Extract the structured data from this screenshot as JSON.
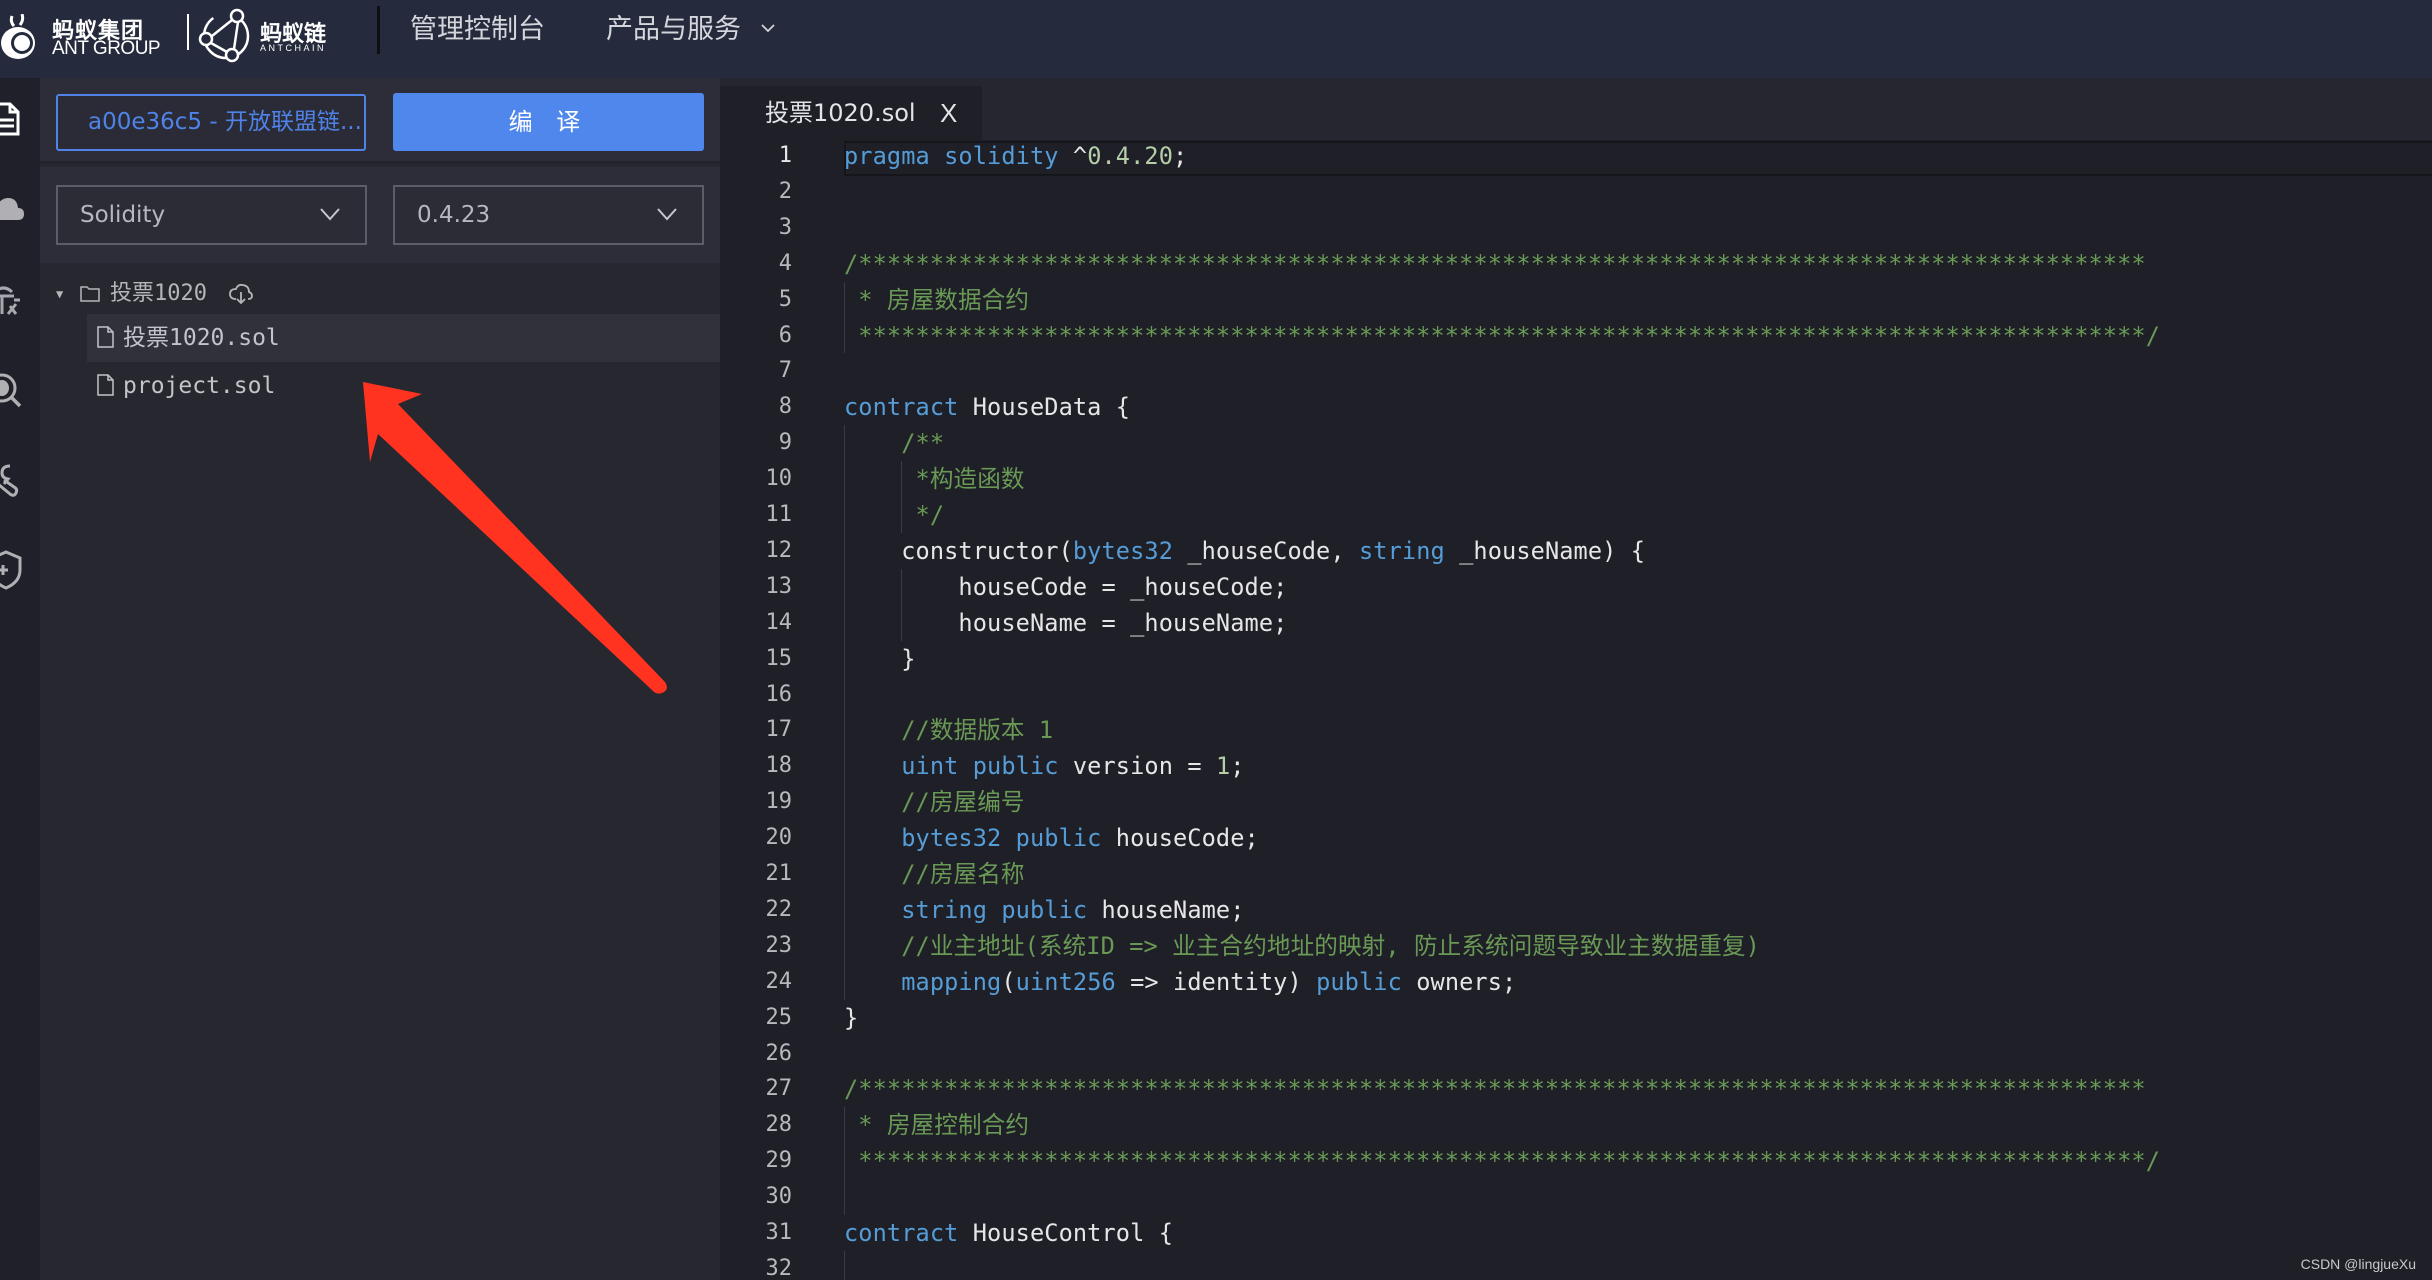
{
  "header": {
    "logo_ant_cn": "蚂蚁集团",
    "logo_ant_en": "ANT GROUP",
    "logo_chain_cn": "蚂蚁链",
    "logo_chain_en": "ANTCHAIN",
    "nav": [
      {
        "label": "管理控制台"
      },
      {
        "label": "产品与服务",
        "icon": "chevron-down-icon"
      }
    ]
  },
  "rail": {
    "icons": [
      "file-icon",
      "cloud-upload-icon",
      "bug-icon",
      "bug-search-icon",
      "wrench-icon",
      "shield-plus-icon"
    ]
  },
  "sidebar": {
    "chain_input": "a00e36c5 - 开放联盟链...",
    "compile_label": "编 译",
    "language_select": "Solidity",
    "version_select": "0.4.23",
    "tree": {
      "folder": {
        "name": "投票1020",
        "expanded": true
      },
      "files": [
        {
          "name": "投票1020.sol",
          "selected": true
        },
        {
          "name": "project.sol",
          "selected": false
        }
      ]
    }
  },
  "editor": {
    "tab": {
      "name": "投票1020.sol",
      "close": "X"
    },
    "active_line": 1,
    "lines": [
      [
        [
          "kw",
          "pragma solidity"
        ],
        [
          "pl",
          " ^"
        ],
        [
          "num",
          "0.4.20"
        ],
        [
          "pl",
          ";"
        ]
      ],
      [],
      [],
      [
        [
          "cm",
          "/******************************************************************************************"
        ]
      ],
      [
        [
          "cm",
          " * 房屋数据合约"
        ]
      ],
      [
        [
          "cm",
          " ******************************************************************************************/"
        ]
      ],
      [],
      [
        [
          "kw",
          "contract"
        ],
        [
          "pl",
          " HouseData {"
        ]
      ],
      [
        [
          "cm",
          "    /**"
        ]
      ],
      [
        [
          "cm",
          "     *构造函数"
        ]
      ],
      [
        [
          "cm",
          "     */"
        ]
      ],
      [
        [
          "pl",
          "    constructor("
        ],
        [
          "kw",
          "bytes32"
        ],
        [
          "pl",
          " _houseCode, "
        ],
        [
          "kw",
          "string"
        ],
        [
          "pl",
          " _houseName) {"
        ]
      ],
      [
        [
          "pl",
          "        houseCode = _houseCode;"
        ]
      ],
      [
        [
          "pl",
          "        houseName = _houseName;"
        ]
      ],
      [
        [
          "pl",
          "    }"
        ]
      ],
      [],
      [
        [
          "cm",
          "    //数据版本 1"
        ]
      ],
      [
        [
          "pl",
          "    "
        ],
        [
          "kw",
          "uint public"
        ],
        [
          "pl",
          " version = "
        ],
        [
          "num",
          "1"
        ],
        [
          "pl",
          ";"
        ]
      ],
      [
        [
          "cm",
          "    //房屋编号"
        ]
      ],
      [
        [
          "pl",
          "    "
        ],
        [
          "kw",
          "bytes32 public"
        ],
        [
          "pl",
          " houseCode;"
        ]
      ],
      [
        [
          "cm",
          "    //房屋名称"
        ]
      ],
      [
        [
          "pl",
          "    "
        ],
        [
          "kw",
          "string public"
        ],
        [
          "pl",
          " houseName;"
        ]
      ],
      [
        [
          "cm",
          "    //业主地址(系统ID => 业主合约地址的映射, 防止系统问题导致业主数据重复)"
        ]
      ],
      [
        [
          "pl",
          "    "
        ],
        [
          "kw",
          "mapping"
        ],
        [
          "pl",
          "("
        ],
        [
          "kw",
          "uint256"
        ],
        [
          "pl",
          " => identity) "
        ],
        [
          "kw",
          "public"
        ],
        [
          "pl",
          " owners;"
        ]
      ],
      [
        [
          "pl",
          "}"
        ]
      ],
      [],
      [
        [
          "cm",
          "/******************************************************************************************"
        ]
      ],
      [
        [
          "cm",
          " * 房屋控制合约"
        ]
      ],
      [
        [
          "cm",
          " ******************************************************************************************/"
        ]
      ],
      [],
      [
        [
          "kw",
          "contract"
        ],
        [
          "pl",
          " HouseControl {"
        ]
      ],
      []
    ]
  },
  "annotation": {
    "type": "red-arrow",
    "points_to": "project.sol",
    "color": "#ff3320"
  },
  "watermark": "CSDN @lingjueXu",
  "colors": {
    "accent": "#5087ec",
    "keyword": "#569cd6",
    "comment": "#6a9955",
    "number": "#b5cea8",
    "header_bg": "#252a3c",
    "editor_bg": "#1e1f27"
  }
}
